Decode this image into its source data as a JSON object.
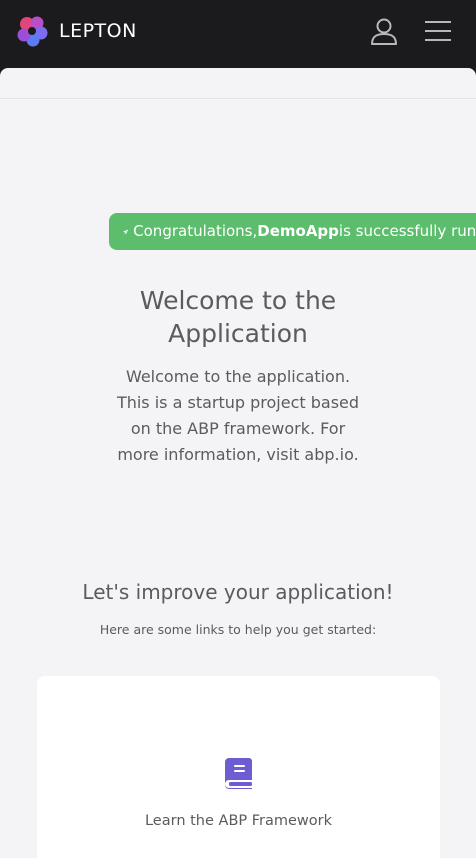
{
  "header": {
    "brand_name": "LEPTON",
    "user_icon": "user-icon",
    "menu_icon": "hamburger-menu-icon"
  },
  "alert": {
    "prefix": "Congratulations, ",
    "app_name": "DemoApp",
    "suffix": " is successfully running",
    "icon": "rocket-icon",
    "color": "#5cbd6d"
  },
  "welcome": {
    "title_line1": "Welcome to the",
    "title_line2": "Application",
    "text_line1": "Welcome to the application.",
    "text_line2": "This is a startup project based",
    "text_line3": "on the ABP framework. For",
    "text_line4": "more information, visit abp.io."
  },
  "improve": {
    "title": "Let's improve your application!",
    "subtitle": "Here are some links to help you get started:"
  },
  "cards": [
    {
      "icon": "book-icon",
      "title": "Learn the ABP Framework"
    }
  ],
  "colors": {
    "topbar": "#1b1b1d",
    "background": "#f4f4f6",
    "icon_accent": "#6c5dd3"
  }
}
